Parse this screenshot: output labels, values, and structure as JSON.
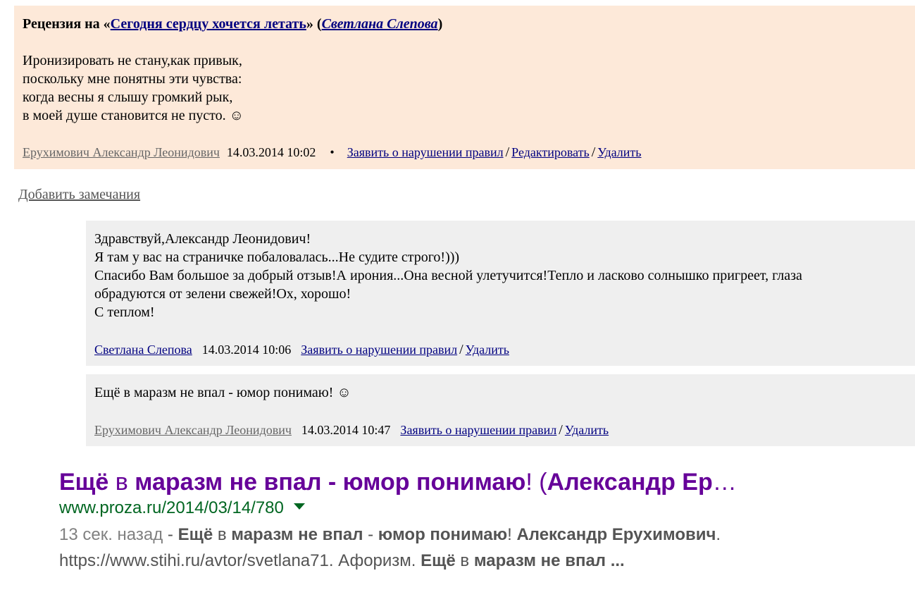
{
  "review": {
    "prefix": "Рецензия на «",
    "work_title": "Сегодня сердцу хочется летать",
    "mid": "» (",
    "work_author": "Светлана Слепова",
    "suffix": ")",
    "poem": [
      "Иронизировать не стану,как привык,",
      "поскольку мне понятны эти чувства:",
      "когда весны я слышу громкий рык,",
      "в моей душе становится не пусто. ☺"
    ],
    "author": "Ерухимович Александр Леонидович",
    "date": "14.03.2014 10:02",
    "bullet": "•",
    "report": "Заявить о нарушении правил",
    "separator": "/",
    "edit": "Редактировать",
    "delete": "Удалить"
  },
  "add_notes": "Добавить замечания",
  "replies": [
    {
      "lines": [
        "Здравствуй,Александр Леонидович!",
        "Я там у вас на страничке побаловалась...Не судите строго!)))",
        "Спасибо Вам большое за добрый отзыв!А ирония...Она весной улетучится!Тепло и ласково солнышко пригреет, глаза",
        "обрадуются от зелени свежей!Ох, хорошо!",
        "С теплом!"
      ],
      "author": "Светлана Слепова",
      "date": "14.03.2014 10:06",
      "report": "Заявить о нарушении правил",
      "separator": "/",
      "delete": "Удалить"
    },
    {
      "lines": [
        "Ещё в маразм не впал - юмор понимаю! ☺"
      ],
      "author": "Ерухимович Александр Леонидович",
      "date": "14.03.2014 10:47",
      "report": "Заявить о нарушении правил",
      "separator": "/",
      "delete": "Удалить"
    }
  ],
  "search_result": {
    "title_parts": [
      "Ещё",
      " в ",
      "маразм не впал",
      " - ",
      "юмор понимаю",
      "! (",
      "Александр Ер",
      "…"
    ],
    "url": "www.proza.ru/2014/03/14/780",
    "snippet_age": "13 сек. назад",
    "snippet_line1_parts": [
      " - ",
      "Ещё",
      " в ",
      "маразм не впал",
      " - ",
      "юмор понимаю",
      "! ",
      "Александр Ерухимович",
      "."
    ],
    "snippet_line2_parts": [
      "https://www.stihi.ru/avtor/svetlana71. Афоризм. ",
      "Ещё",
      " в ",
      "маразм не впал ..."
    ]
  },
  "colors": {
    "review_bg": "#fde9d9",
    "reply_bg": "#efefef",
    "link": "#000080",
    "serp_title": "#660099",
    "serp_url": "#006621"
  }
}
